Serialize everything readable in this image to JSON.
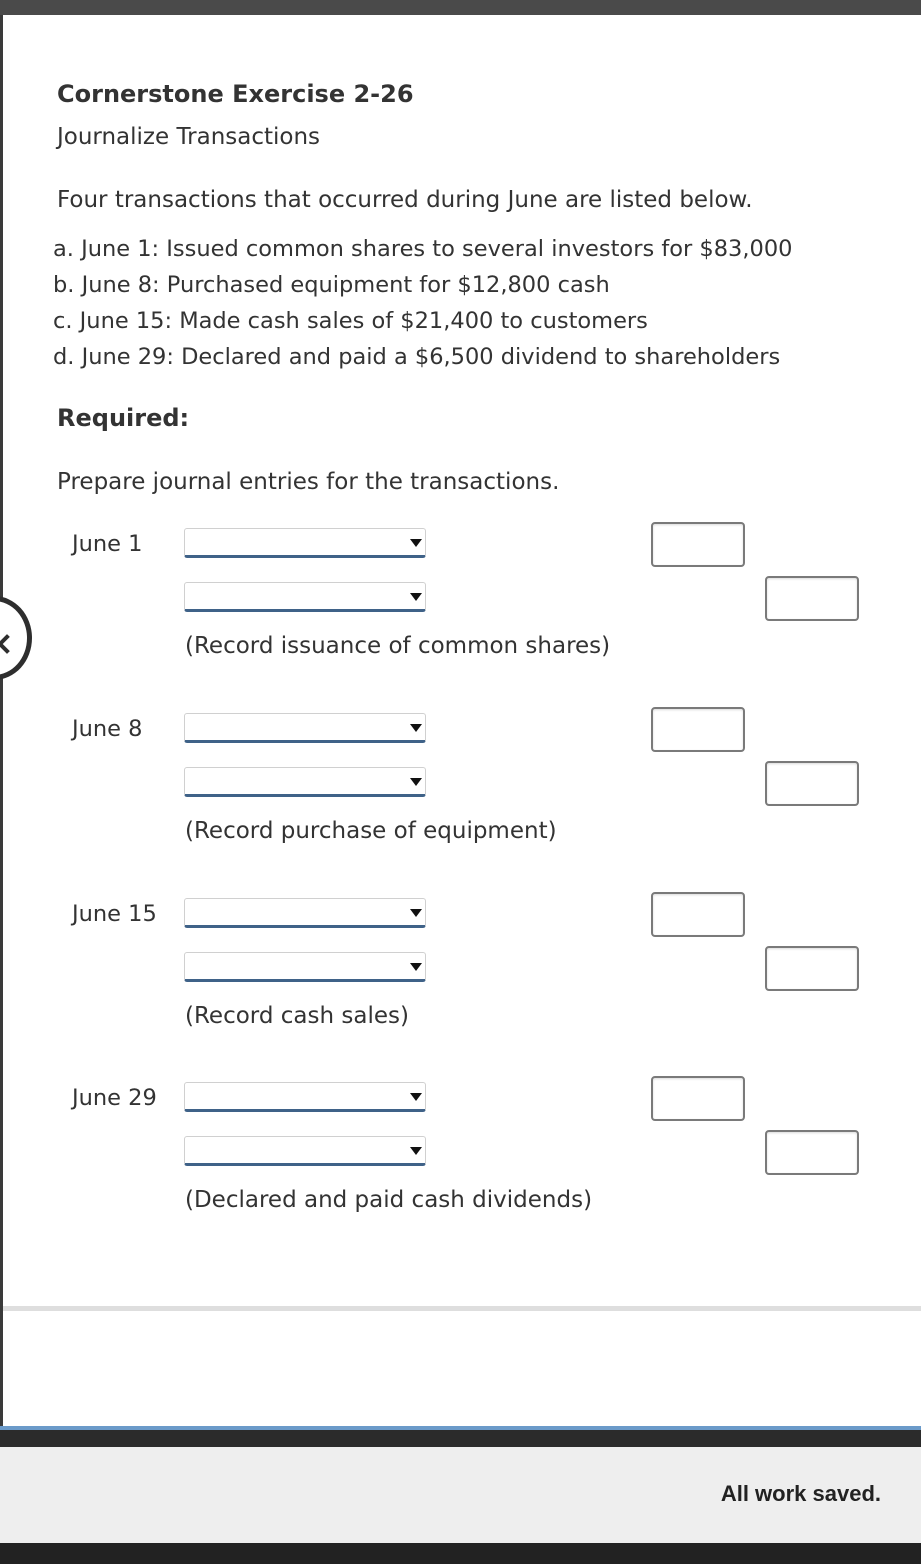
{
  "exercise": {
    "title": "Cornerstone Exercise 2-26",
    "subtitle": "Journalize Transactions",
    "intro": "Four transactions that occurred during June are listed below.",
    "transactions": [
      "a.  June 1: Issued common shares to several investors for $83,000",
      "b.  June 8: Purchased equipment for $12,800 cash",
      "c.  June 15: Made cash sales of $21,400 to customers",
      "d.  June 29: Declared and paid a $6,500 dividend to shareholders"
    ],
    "required_label": "Required:",
    "instruction": "Prepare journal entries for the transactions."
  },
  "entries": [
    {
      "date": "June 1",
      "memo": "(Record issuance of common shares)"
    },
    {
      "date": "June 8",
      "memo": "(Record purchase of equipment)"
    },
    {
      "date": "June 15",
      "memo": "(Record cash sales)"
    },
    {
      "date": "June 29",
      "memo": "(Declared and paid cash dividends)"
    }
  ],
  "status": {
    "text": "All work saved."
  },
  "colors": {
    "select_underline": "#3f6288",
    "blue_rule": "#6b9ac9",
    "status_bg": "#eeeeee"
  }
}
